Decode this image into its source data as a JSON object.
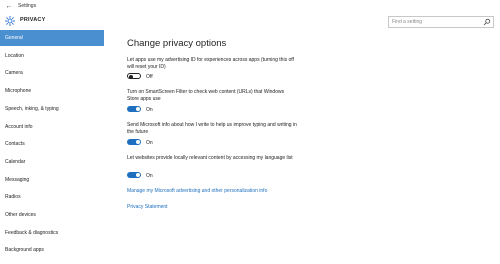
{
  "window": {
    "title": "Settings"
  },
  "header": {
    "section": "PRIVACY",
    "search_placeholder": "Find a setting"
  },
  "sidebar": {
    "items": [
      {
        "label": "General",
        "selected": true
      },
      {
        "label": "Location"
      },
      {
        "label": "Camera"
      },
      {
        "label": "Microphone"
      },
      {
        "label": "Speech, inking, & typing"
      },
      {
        "label": "Account info"
      },
      {
        "label": "Contacts"
      },
      {
        "label": "Calendar"
      },
      {
        "label": "Messaging"
      },
      {
        "label": "Radios"
      },
      {
        "label": "Other devices"
      },
      {
        "label": "Feedback & diagnostics"
      },
      {
        "label": "Background apps"
      }
    ]
  },
  "main": {
    "title": "Change privacy options",
    "options": [
      {
        "text": "Let apps use my advertising ID for experiences across apps (turning this off will reset your ID)",
        "state": "Off",
        "on": false
      },
      {
        "text": "Turn on SmartScreen Filter to check web content (URLs) that Windows Store apps use",
        "state": "On",
        "on": true
      },
      {
        "text": "Send Microsoft info about how I write to help us improve typing and writing in the future",
        "state": "On",
        "on": true
      },
      {
        "text": "Let websites provide locally relevant content by accessing my language list",
        "state": "On",
        "on": true
      }
    ],
    "links": {
      "manage": "Manage my Microsoft advertising and other personalization info",
      "statement": "Privacy Statement"
    }
  },
  "colors": {
    "accent": "#1e6fbf",
    "selected_bg": "#4a8fcf"
  }
}
